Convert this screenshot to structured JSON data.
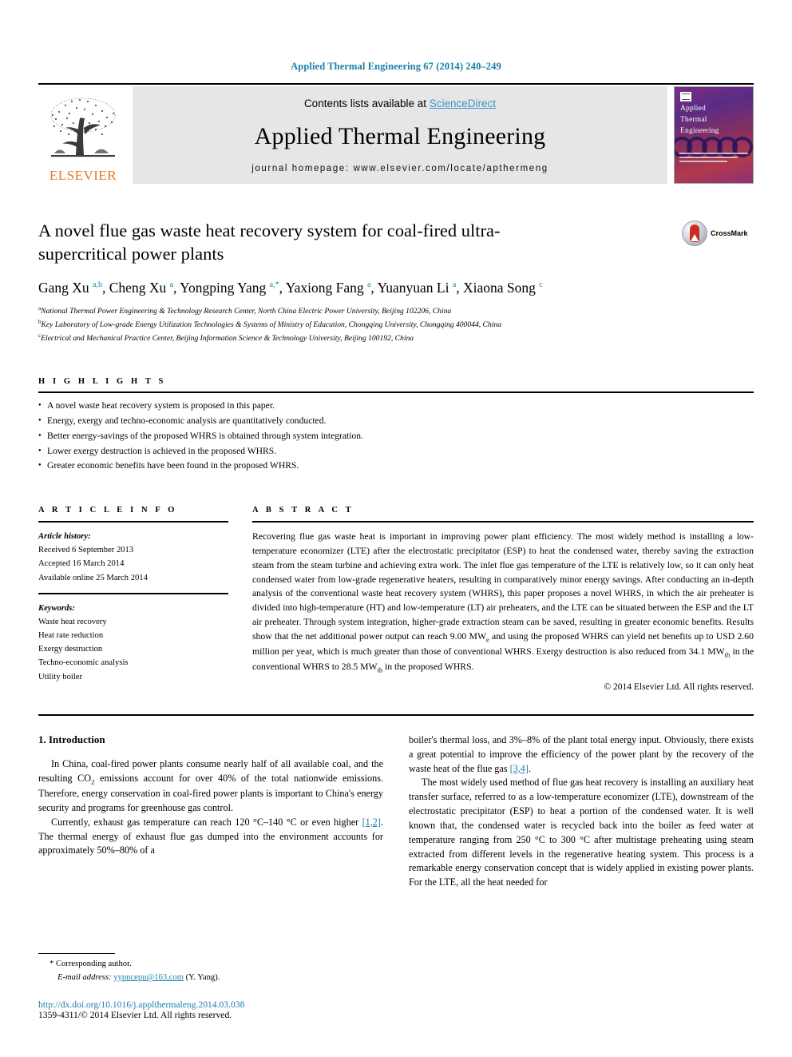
{
  "running_head": "Applied Thermal Engineering 67 (2014) 240–249",
  "masthead": {
    "contents_prefix": "Contents lists available at ",
    "sciencedirect": "ScienceDirect",
    "journal_title": "Applied Thermal Engineering",
    "homepage": "journal homepage: www.elsevier.com/locate/apthermeng",
    "publisher": "ELSEVIER",
    "cover": {
      "line1": "Applied",
      "line2": "Thermal",
      "line3": "Engineering"
    }
  },
  "article": {
    "title": "A novel flue gas waste heat recovery system for coal-fired ultra-supercritical power plants",
    "crossmark_label": "CrossMark",
    "authors_html": "Gang Xu <sup>a,b</sup>, Cheng Xu <sup>a</sup>, Yongping Yang <sup>a,*</sup>, Yaxiong Fang <sup>a</sup>, Yuanyuan Li <sup>a</sup>, Xiaona Song <sup>c</sup>",
    "affiliations": [
      "National Thermal Power Engineering & Technology Research Center, North China Electric Power University, Beijing 102206, China",
      "Key Laboratory of Low-grade Energy Utilization Technologies & Systems of Ministry of Education, Chongqing University, Chongqing 400044, China",
      "Electrical and Mechanical Practice Center, Beijing Information Science & Technology University, Beijing 100192, China"
    ],
    "affiliation_marks": [
      "a",
      "b",
      "c"
    ]
  },
  "highlights": {
    "heading": "H I G H L I G H T S",
    "items": [
      "A novel waste heat recovery system is proposed in this paper.",
      "Energy, exergy and techno-economic analysis are quantitatively conducted.",
      "Better energy-savings of the proposed WHRS is obtained through system integration.",
      "Lower exergy destruction is achieved in the proposed WHRS.",
      "Greater economic benefits have been found in the proposed WHRS."
    ]
  },
  "article_info": {
    "heading": "A R T I C L E  I N F O",
    "history_label": "Article history:",
    "history": [
      "Received 6 September 2013",
      "Accepted 16 March 2014",
      "Available online 25 March 2014"
    ],
    "keywords_label": "Keywords:",
    "keywords": [
      "Waste heat recovery",
      "Heat rate reduction",
      "Exergy destruction",
      "Techno-economic analysis",
      "Utility boiler"
    ]
  },
  "abstract": {
    "heading": "A B S T R A C T",
    "text": "Recovering flue gas waste heat is important in improving power plant efficiency. The most widely method is installing a low-temperature economizer (LTE) after the electrostatic precipitator (ESP) to heat the condensed water, thereby saving the extraction steam from the steam turbine and achieving extra work. The inlet flue gas temperature of the LTE is relatively low, so it can only heat condensed water from low-grade regenerative heaters, resulting in comparatively minor energy savings. After conducting an in-depth analysis of the conventional waste heat recovery system (WHRS), this paper proposes a novel WHRS, in which the air preheater is divided into high-temperature (HT) and low-temperature (LT) air preheaters, and the LTE can be situated between the ESP and the LT air preheater. Through system integration, higher-grade extraction steam can be saved, resulting in greater economic benefits. Results show that the net additional power output can reach 9.00 MW",
    "text_sub1": "e",
    "text_cont1": " and using the proposed WHRS can yield net benefits up to USD 2.60 million per year, which is much greater than those of conventional WHRS. Exergy destruction is also reduced from 34.1 MW",
    "text_sub2": "th",
    "text_cont2": " in the conventional WHRS to 28.5 MW",
    "text_sub3": "th",
    "text_cont3": " in the proposed WHRS.",
    "copyright": "© 2014 Elsevier Ltd. All rights reserved."
  },
  "body": {
    "section_number_title": "1.  Introduction",
    "left_p1_a": "In China, coal-fired power plants consume nearly half of all available coal, and the resulting CO",
    "left_p1_sub": "2",
    "left_p1_b": " emissions account for over 40% of the total nationwide emissions. Therefore, energy conservation in coal-fired power plants is important to China's energy security and programs for greenhouse gas control.",
    "left_p2_a": "Currently, exhaust gas temperature can reach 120 °C–140 °C or even higher ",
    "left_p2_ref": "[1,2]",
    "left_p2_b": ". The thermal energy of exhaust flue gas dumped into the environment accounts for approximately 50%–80% of a",
    "right_p1_a": "boiler's thermal loss, and 3%–8% of the plant total energy input. Obviously, there exists a great potential to improve the efficiency of the power plant by the recovery of the waste heat of the flue gas ",
    "right_p1_ref": "[3,4]",
    "right_p1_b": ".",
    "right_p2": "The most widely used method of flue gas heat recovery is installing an auxiliary heat transfer surface, referred to as a low-temperature economizer (LTE), downstream of the electrostatic precipitator (ESP) to heat a portion of the condensed water. It is well known that, the condensed water is recycled back into the boiler as feed water at temperature ranging from 250 °C to 300 °C after multistage preheating using steam extracted from different levels in the regenerative heating system. This process is a remarkable energy conservation concept that is widely applied in existing power plants. For the LTE, all the heat needed for"
  },
  "footer": {
    "corresponding": "* Corresponding author.",
    "email_label": "E-mail address:",
    "email": "yypncepu@163.com",
    "email_owner": "(Y. Yang).",
    "doi": "http://dx.doi.org/10.1016/j.applthermaleng.2014.03.038",
    "issn": "1359-4311/© 2014 Elsevier Ltd. All rights reserved."
  },
  "colors": {
    "link": "#1a7fa8",
    "sciencedirect": "#3b96c9",
    "elsevier_orange": "#e87722"
  }
}
